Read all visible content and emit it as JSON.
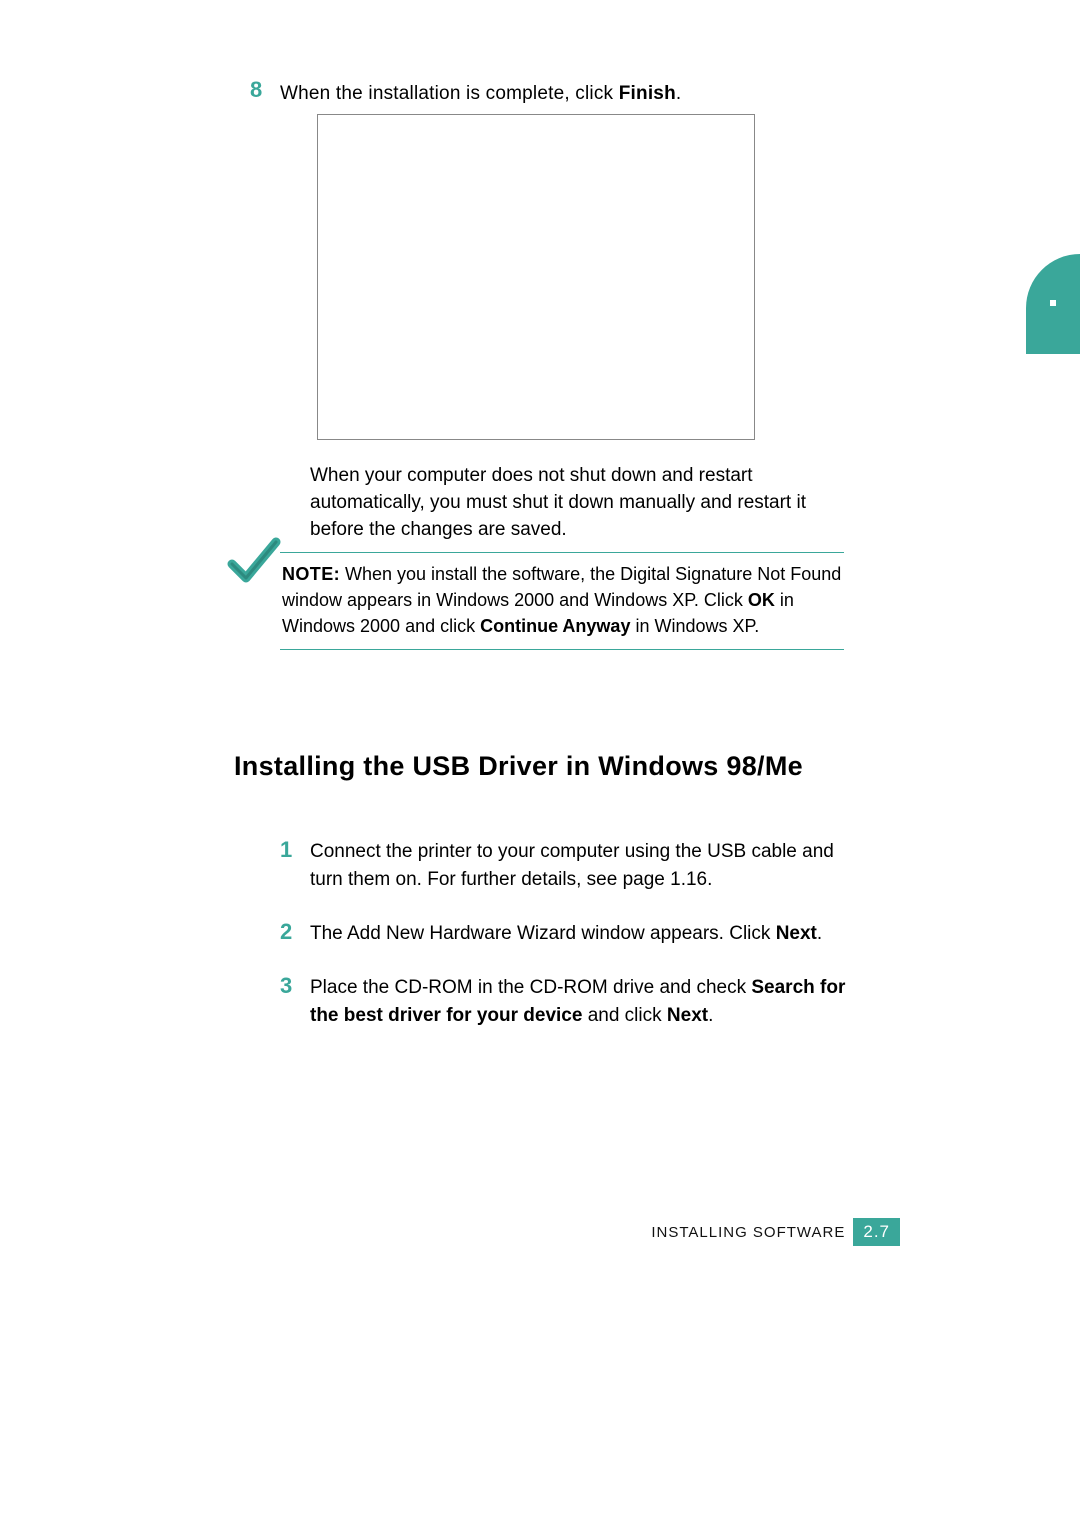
{
  "colors": {
    "accent": "#3aa79a"
  },
  "sideTab": {
    "label": ""
  },
  "step8": {
    "num": "8",
    "pre": "When the installation is complete, click ",
    "bold": "Finish",
    "post": "."
  },
  "afterImage": "When your computer does not shut down and restart automatically, you must shut it down manually and restart it before the changes are saved.",
  "note": {
    "label": "NOTE:",
    "t1": " When you install the software, the Digital Signature Not Found window appears in Windows 2000 and Windows XP. Click ",
    "b1": "OK",
    "t2": " in Windows 2000 and click ",
    "b2": "Continue Anyway",
    "t3": " in Windows XP."
  },
  "heading": "Installing the USB Driver in Windows 98/Me",
  "steps": {
    "s1": {
      "num": "1",
      "text": "Connect the printer to your computer using the USB cable and turn them on. For further details, see page 1.16."
    },
    "s2": {
      "num": "2",
      "pre": "The Add New Hardware Wizard window appears. Click ",
      "bold": "Next",
      "post": "."
    },
    "s3": {
      "num": "3",
      "pre": "Place the CD-ROM in the CD-ROM drive and check ",
      "bold1": "Search for the best driver for your device",
      "mid": " and click ",
      "bold2": "Next",
      "post": "."
    }
  },
  "footer": {
    "label": "INSTALLING SOFTWARE",
    "page": "2.7"
  }
}
